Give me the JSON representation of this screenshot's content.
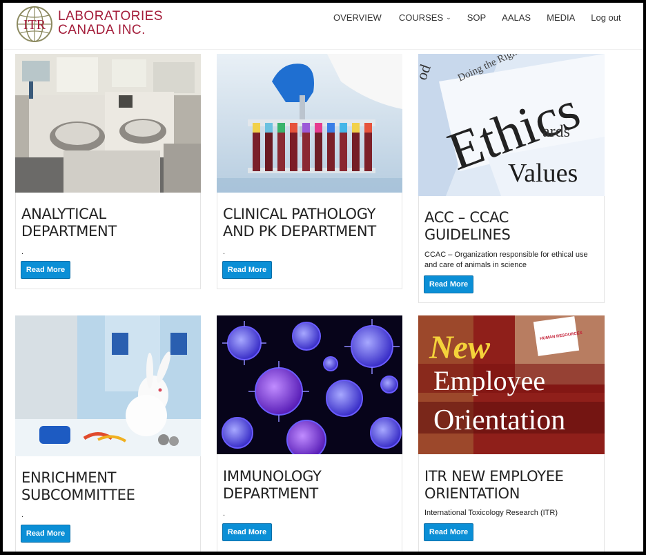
{
  "brand": {
    "monogram": "ITR",
    "line1": "LABORATORIES",
    "line2": "CANADA INC.",
    "color": "#a41d3a"
  },
  "nav": {
    "overview": "OVERVIEW",
    "courses": "COURSES",
    "sop": "SOP",
    "aalas": "AALAS",
    "media": "MEDIA",
    "logout": "Log out"
  },
  "cards": [
    {
      "title_l1": "ANALYTICAL",
      "title_l2": "DEPARTMENT",
      "desc": ".",
      "button": "Read More"
    },
    {
      "title_l1": "CLINICAL PATHOLOGY",
      "title_l2": "AND PK DEPARTMENT",
      "desc": ".",
      "button": "Read More"
    },
    {
      "title_l1": "ACC – CCAC",
      "title_l2": "GUIDELINES",
      "desc": "CCAC – Organization responsible for ethical use and care of animals in science",
      "button": "Read More",
      "image_text": {
        "ethics": "Ethics",
        "values": "Values",
        "wards": "ards",
        "doing": "Doing the Right",
        "od": "od"
      }
    },
    {
      "title_l1": "ENRICHMENT",
      "title_l2": "SUBCOMMITTEE",
      "desc": ".",
      "button": "Read More"
    },
    {
      "title_l1": "IMMUNOLOGY",
      "title_l2": "DEPARTMENT",
      "desc": ".",
      "button": "Read More"
    },
    {
      "title_l1": "ITR NEW EMPLOYEE",
      "title_l2": "ORIENTATION",
      "desc": "International Toxicology Research (ITR)",
      "button": "Read More",
      "image_text": {
        "new": "New",
        "employee": "Employee",
        "orientation": "Orientation",
        "book": "HUMAN RESOURCES"
      }
    }
  ],
  "colors": {
    "button": "#0b8fd6",
    "title": "#222222"
  }
}
